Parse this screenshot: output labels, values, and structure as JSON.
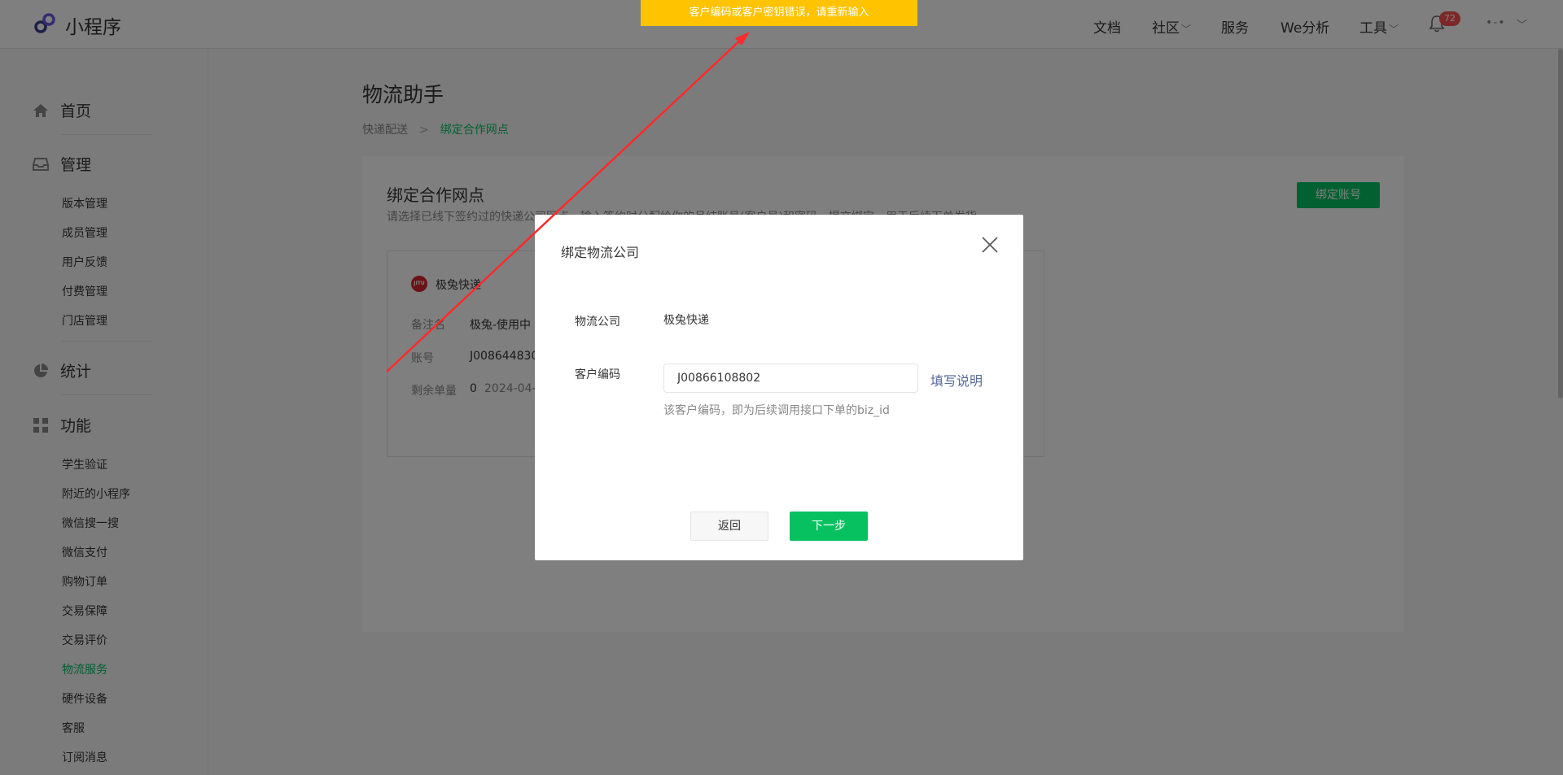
{
  "header": {
    "logo_text": "小程序",
    "nav": [
      {
        "label": "文档",
        "dropdown": false
      },
      {
        "label": "社区",
        "dropdown": true
      },
      {
        "label": "服务",
        "dropdown": false
      },
      {
        "label": "We分析",
        "dropdown": false
      },
      {
        "label": "工具",
        "dropdown": true
      }
    ],
    "notification_count": "72",
    "account_label": "•-•"
  },
  "sidebar": {
    "sections": [
      {
        "label": "首页",
        "icon": "home-icon"
      },
      {
        "label": "管理",
        "icon": "inbox-icon",
        "items": [
          "版本管理",
          "成员管理",
          "用户反馈",
          "付费管理",
          "门店管理"
        ]
      },
      {
        "label": "统计",
        "icon": "pie-chart-icon"
      },
      {
        "label": "功能",
        "icon": "grid-icon",
        "items": [
          "学生验证",
          "附近的小程序",
          "微信搜一搜",
          "微信支付",
          "购物订单",
          "交易保障",
          "交易评价",
          "物流服务",
          "硬件设备",
          "客服",
          "订阅消息"
        ]
      }
    ],
    "active_item": "物流服务"
  },
  "main": {
    "title": "物流助手",
    "breadcrumb": [
      "快递配送",
      "绑定合作网点"
    ],
    "panel": {
      "title": "绑定合作网点",
      "description": "请选择已线下签约过的快递公司网点，输入签约时分配给你的月结账号(客户号)和密码，提交绑定，用于后续下单发货",
      "bind_button": "绑定账号",
      "card": {
        "logo_text": "JITU",
        "company": "极兔快递",
        "rows": [
          {
            "label": "备注名",
            "value": "极兔-使用中",
            "extra": ""
          },
          {
            "label": "账号",
            "value": "J008644830",
            "extra": ""
          },
          {
            "label": "剩余单量",
            "value": "0",
            "extra": "2024-04-"
          }
        ]
      }
    }
  },
  "modal": {
    "title": "绑定物流公司",
    "company_label": "物流公司",
    "company_value": "极兔快递",
    "code_label": "客户编码",
    "code_value": "J00866108802",
    "help_link": "填写说明",
    "hint": "该客户编码，即为后续调用接口下单的biz_id",
    "back_button": "返回",
    "next_button": "下一步"
  },
  "toast": {
    "message": "客户编码或客户密钥错误，请重新输入",
    "color": "#ffc300"
  },
  "colors": {
    "accent": "#07c160",
    "link": "#576b95",
    "badge": "#fa5151",
    "annotation": "#ff2a2a"
  }
}
